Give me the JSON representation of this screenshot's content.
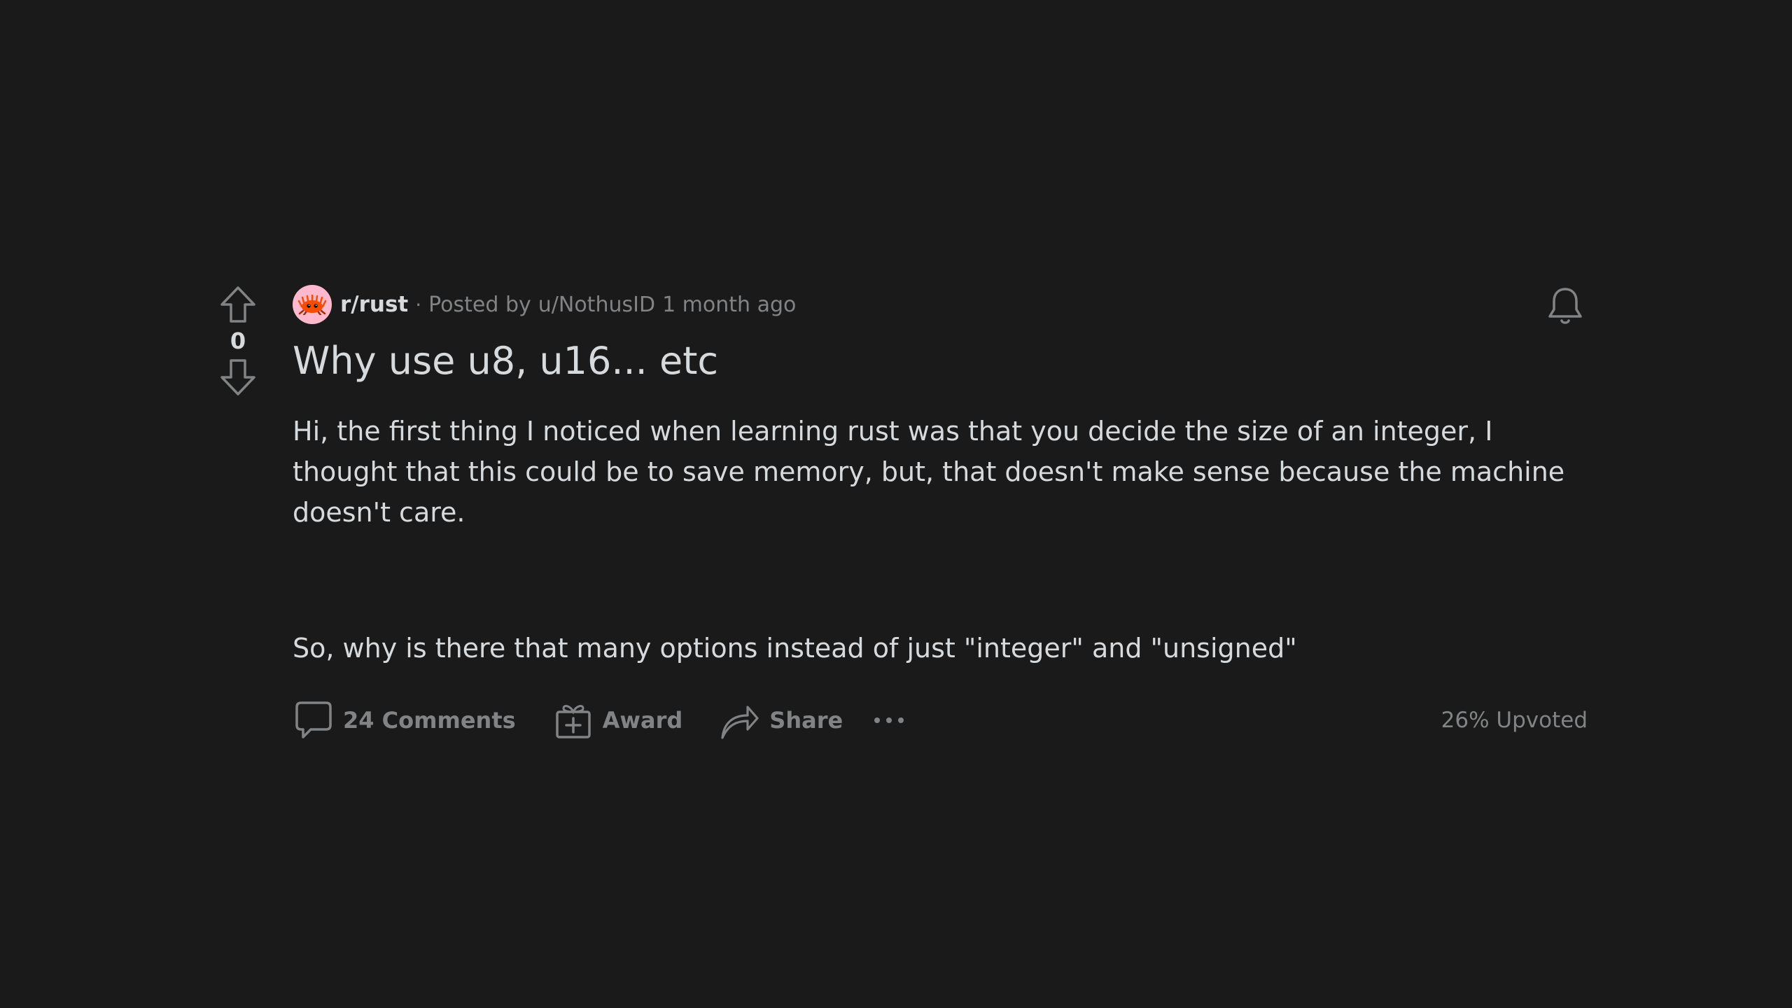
{
  "post": {
    "score": "0",
    "subreddit": "r/rust",
    "separator": "·",
    "posted_by_prefix": "Posted by",
    "author": "u/NothusID",
    "time_ago": "1 month ago",
    "title": "Why use u8, u16... etc",
    "body": [
      "Hi, the first thing I noticed when learning rust was that you decide the size of an integer, I thought that this could be to save memory, but, that doesn't make sense because the machine doesn't care.",
      "So, why is there that many options instead of just \"integer\" and \"unsigned\""
    ],
    "actions": {
      "comments": "24 Comments",
      "award": "Award",
      "share": "Share"
    },
    "upvoted": "26% Upvoted"
  },
  "icons": {
    "upvote": "upvote-arrow-icon",
    "downvote": "downvote-arrow-icon",
    "bell": "bell-icon",
    "comment": "comment-bubble-icon",
    "award": "gift-award-icon",
    "share": "share-arrow-icon",
    "more": "more-dots-icon",
    "subreddit_avatar": "ferris-crab-icon"
  },
  "colors": {
    "background": "#1a1a1b",
    "text": "#d7dadc",
    "muted": "#818384",
    "avatar_bg": "#ffb8cc",
    "ferris": "#f74c00"
  }
}
